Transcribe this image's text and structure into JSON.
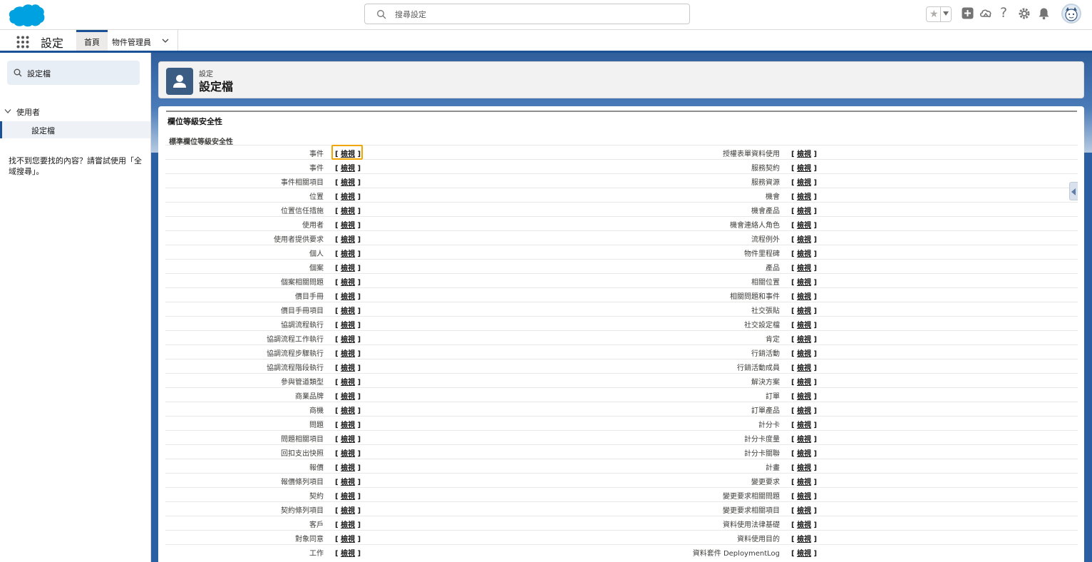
{
  "header": {
    "search_placeholder": "搜尋設定"
  },
  "context": {
    "app_name": "設定",
    "tabs": [
      {
        "label": "首頁"
      },
      {
        "label": "物件管理員"
      }
    ]
  },
  "sidebar": {
    "quickfind_value": "設定檔",
    "tree_parent": "使用者",
    "tree_child": "設定檔",
    "not_found_text": "找不到您要找的內容？請嘗試使用「全域搜尋」。"
  },
  "page_header": {
    "kicker": "設定",
    "title": "設定檔"
  },
  "section": {
    "title": "欄位等級安全性",
    "subtitle": "標準欄位等級安全性",
    "view_label": "檢視",
    "rows": [
      {
        "left": "事件",
        "right": "授權表單資料使用"
      },
      {
        "left": "事件",
        "right": "服務契約"
      },
      {
        "left": "事件相關項目",
        "right": "服務資源"
      },
      {
        "left": "位置",
        "right": "機會"
      },
      {
        "left": "位置信任措施",
        "right": "機會產品"
      },
      {
        "left": "使用者",
        "right": "機會連絡人角色"
      },
      {
        "left": "使用者提供要求",
        "right": "流程例外"
      },
      {
        "left": "個人",
        "right": "物件里程碑"
      },
      {
        "left": "個案",
        "right": "產品"
      },
      {
        "left": "個案相關問題",
        "right": "相關位置"
      },
      {
        "left": "價目手冊",
        "right": "相關問題和事件"
      },
      {
        "left": "價目手冊項目",
        "right": "社交張貼"
      },
      {
        "left": "協調流程執行",
        "right": "社交設定檔"
      },
      {
        "left": "協調流程工作執行",
        "right": "肯定"
      },
      {
        "left": "協調流程步驟執行",
        "right": "行銷活動"
      },
      {
        "left": "協調流程階段執行",
        "right": "行銷活動成員"
      },
      {
        "left": "參與管道類型",
        "right": "解決方案"
      },
      {
        "left": "商業品牌",
        "right": "訂單"
      },
      {
        "left": "商機",
        "right": "訂單產品"
      },
      {
        "left": "問題",
        "right": "計分卡"
      },
      {
        "left": "問題相關項目",
        "right": "計分卡度量"
      },
      {
        "left": "回扣支出快照",
        "right": "計分卡關聯"
      },
      {
        "left": "報價",
        "right": "計畫"
      },
      {
        "left": "報價條列項目",
        "right": "變更要求"
      },
      {
        "left": "契約",
        "right": "變更要求相關問題"
      },
      {
        "left": "契約條列項目",
        "right": "變更要求相關項目"
      },
      {
        "left": "客戶",
        "right": "資料使用法律基礎"
      },
      {
        "left": "對象同意",
        "right": "資料使用目的"
      },
      {
        "left": "工作",
        "right": "資料套件 DeploymentLog"
      }
    ]
  }
}
